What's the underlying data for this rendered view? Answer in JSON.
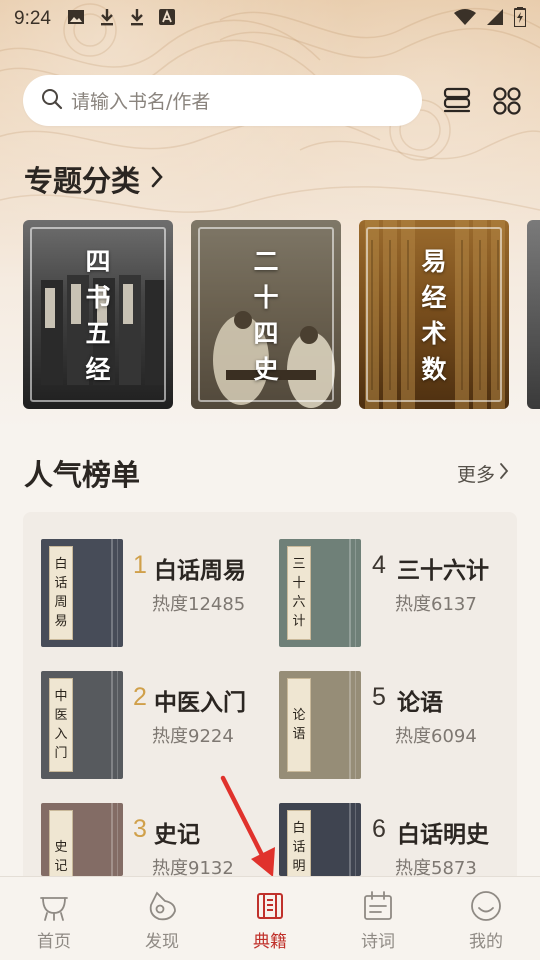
{
  "status_bar": {
    "time": "9:24"
  },
  "search": {
    "placeholder": "请输入书名/作者"
  },
  "topics": {
    "title": "专题分类",
    "cards": [
      {
        "label": "四书五经"
      },
      {
        "label": "二十四史"
      },
      {
        "label": "易经术数"
      }
    ]
  },
  "ranking": {
    "title": "人气榜单",
    "more": "更多",
    "books": [
      {
        "rank": "1",
        "name": "白话周易",
        "heat": "热度12485",
        "cover_label": "白话周易",
        "cover_color": "#474c58"
      },
      {
        "rank": "2",
        "name": "中医入门",
        "heat": "热度9224",
        "cover_label": "中医入门",
        "cover_color": "#575a5e"
      },
      {
        "rank": "3",
        "name": "史记",
        "heat": "热度9132",
        "cover_label": "史记",
        "cover_color": "#836c65"
      },
      {
        "rank": "4",
        "name": "三十六计",
        "heat": "热度6137",
        "cover_label": "三十六计",
        "cover_color": "#6f8078"
      },
      {
        "rank": "5",
        "name": "论语",
        "heat": "热度6094",
        "cover_label": "论语",
        "cover_color": "#968d77"
      },
      {
        "rank": "6",
        "name": "白话明史",
        "heat": "热度5873",
        "cover_label": "白话明史",
        "cover_color": "#3f4450"
      }
    ]
  },
  "tabbar": {
    "tabs": [
      {
        "label": "首页",
        "icon": "home-pot-icon"
      },
      {
        "label": "发现",
        "icon": "discover-icon"
      },
      {
        "label": "典籍",
        "icon": "classics-book-icon",
        "active": true
      },
      {
        "label": "诗词",
        "icon": "calendar-poetry-icon"
      },
      {
        "label": "我的",
        "icon": "smiley-profile-icon"
      }
    ]
  },
  "colors": {
    "accent": "#c0312b",
    "gold_rank": "#d0a04a",
    "background": "#f7f3ee"
  }
}
